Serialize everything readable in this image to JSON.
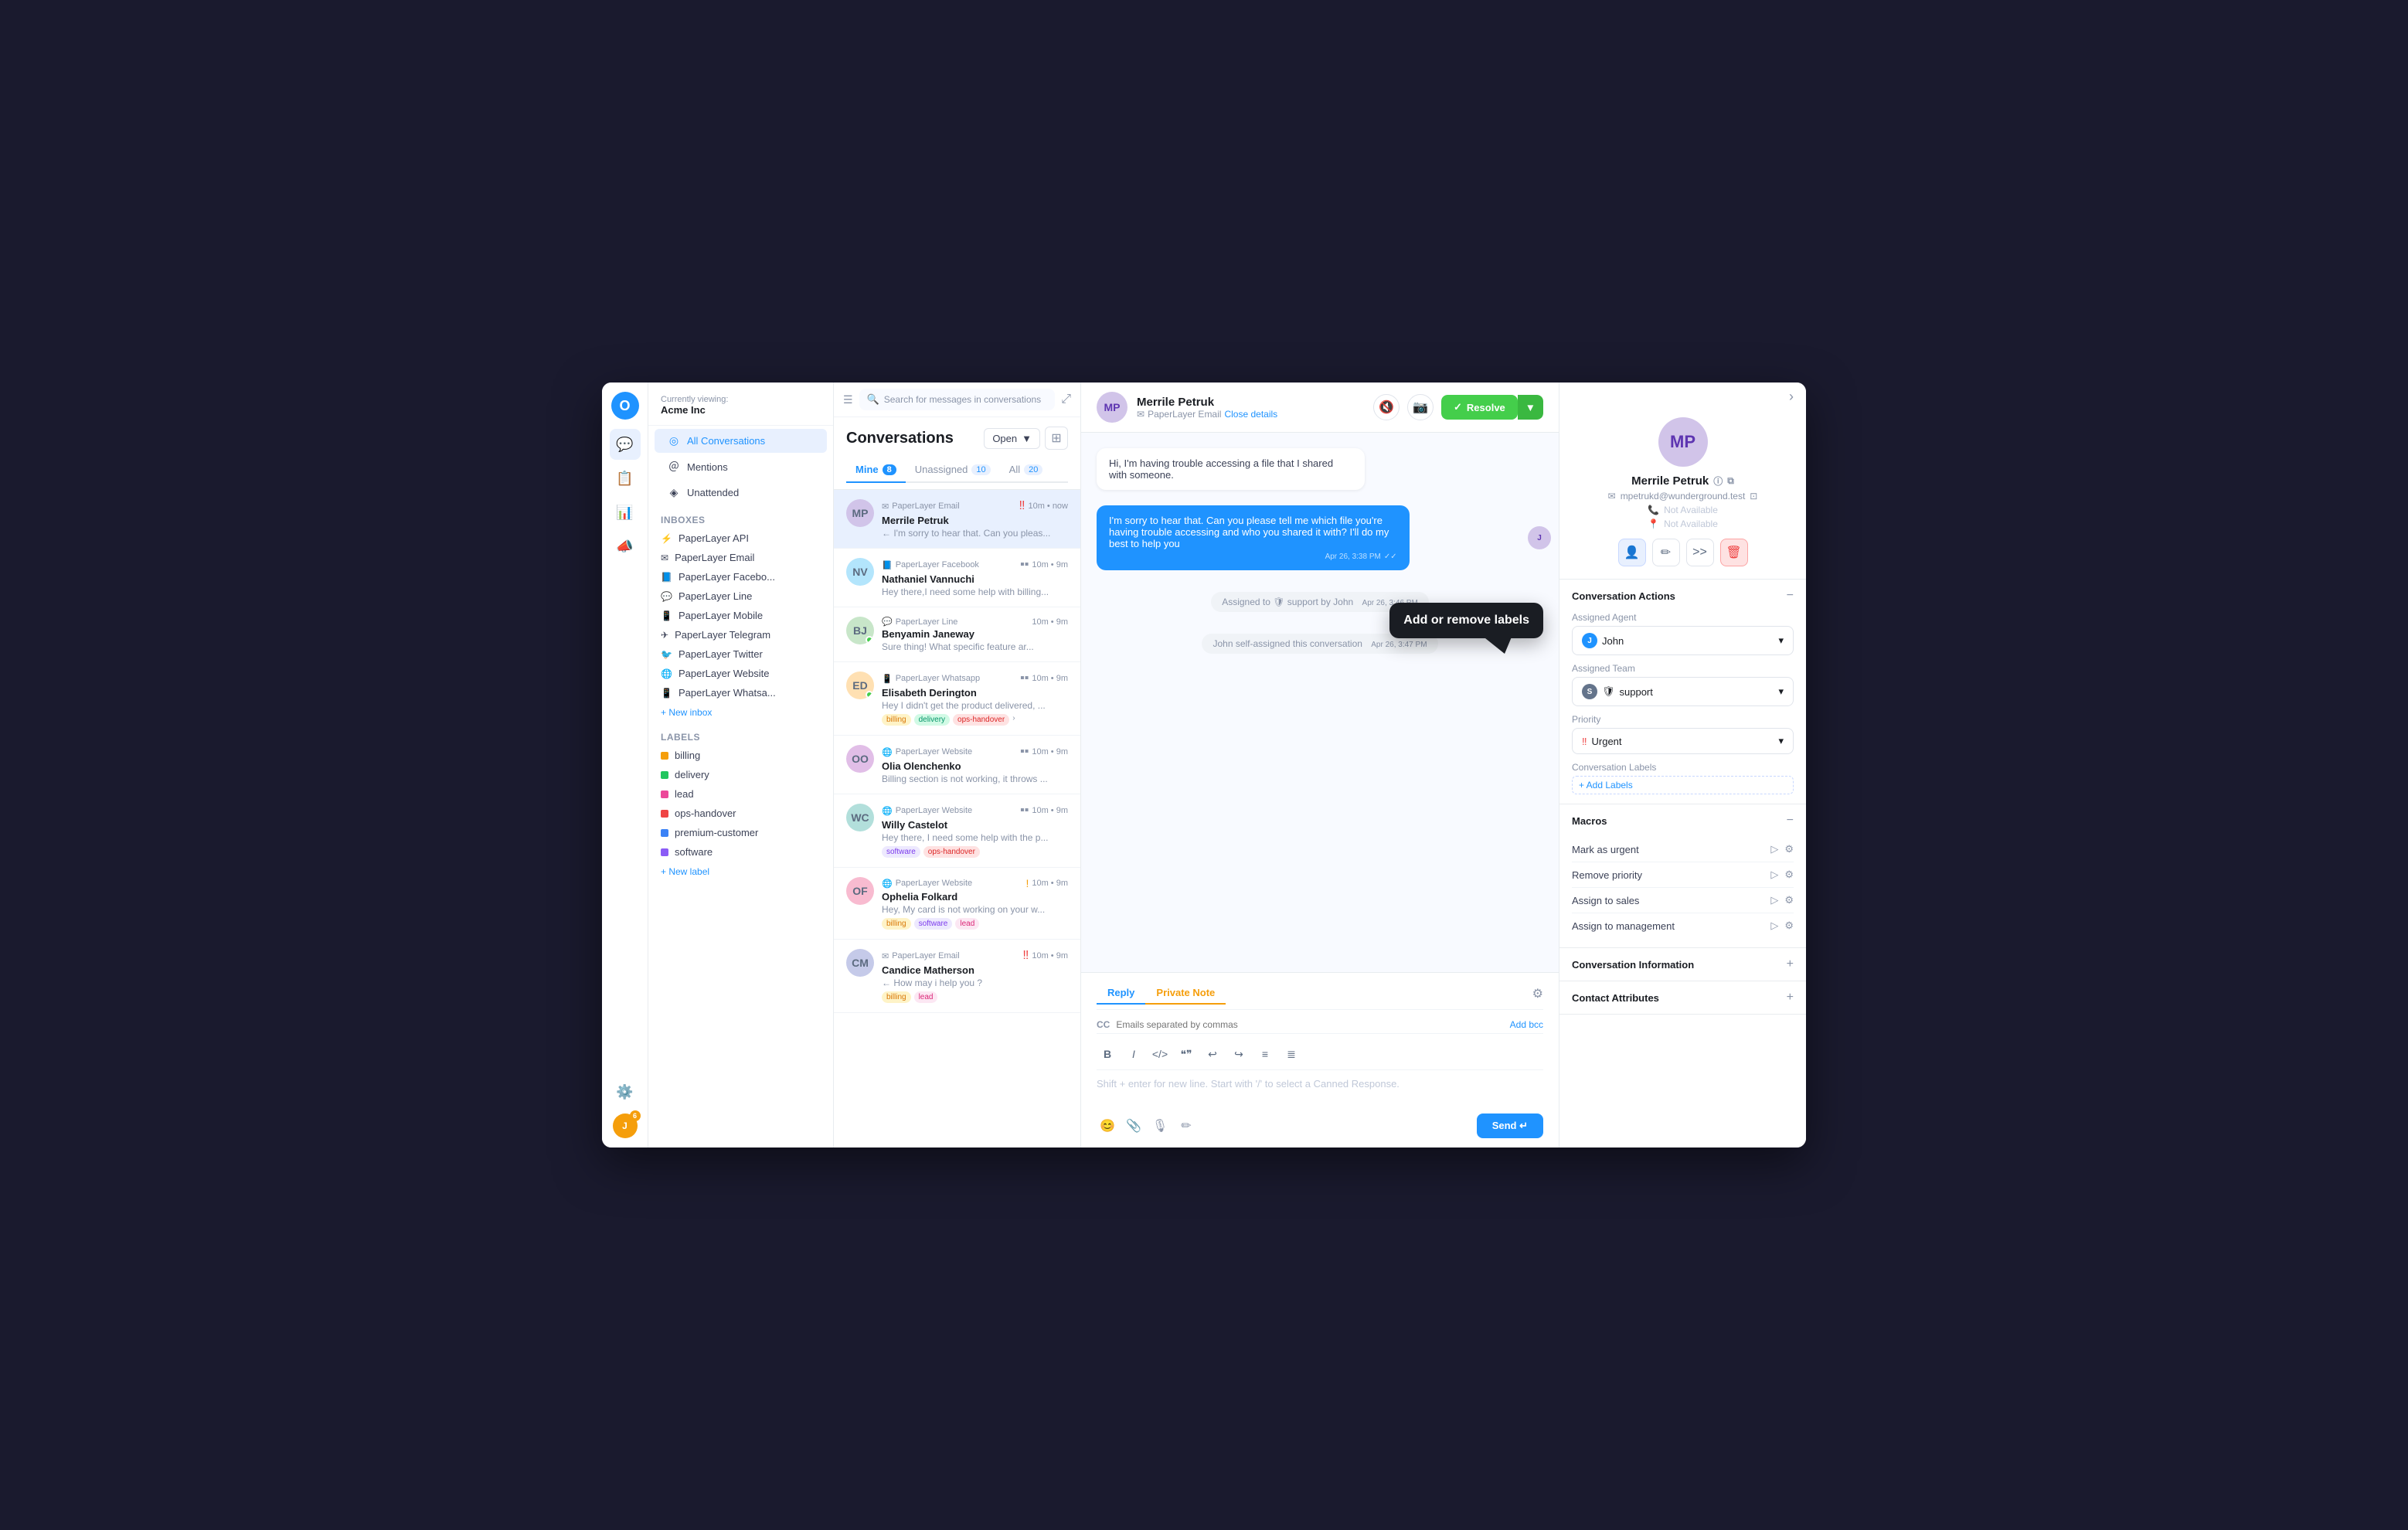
{
  "app": {
    "logo": "O",
    "viewing_label": "Currently viewing:",
    "company": "Acme Inc"
  },
  "left_nav": {
    "icons": [
      "💬",
      "📋",
      "📊",
      "📣",
      "⚙️"
    ],
    "notification_count": "6"
  },
  "sidebar": {
    "conversations_section": {
      "items": [
        {
          "id": "all",
          "label": "All Conversations",
          "icon": "◎",
          "active": true
        },
        {
          "id": "mentions",
          "label": "Mentions",
          "icon": "＠"
        },
        {
          "id": "unattended",
          "label": "Unattended",
          "icon": "◈"
        }
      ]
    },
    "inboxes_title": "Inboxes",
    "inboxes": [
      {
        "label": "PaperLayer API",
        "icon": "⚡"
      },
      {
        "label": "PaperLayer Email",
        "icon": "✉"
      },
      {
        "label": "PaperLayer Facebo...",
        "icon": "📘"
      },
      {
        "label": "PaperLayer Line",
        "icon": "💬"
      },
      {
        "label": "PaperLayer Mobile",
        "icon": "📱"
      },
      {
        "label": "PaperLayer Telegram",
        "icon": "✈"
      },
      {
        "label": "PaperLayer Twitter",
        "icon": "🐦"
      },
      {
        "label": "PaperLayer Website",
        "icon": "🌐"
      },
      {
        "label": "PaperLayer Whatsa...",
        "icon": "📱"
      }
    ],
    "new_inbox": "+ New inbox",
    "labels_title": "Labels",
    "labels": [
      {
        "label": "billing",
        "color": "#f59e0b"
      },
      {
        "label": "delivery",
        "color": "#22c55e"
      },
      {
        "label": "lead",
        "color": "#ec4899"
      },
      {
        "label": "ops-handover",
        "color": "#ef4444"
      },
      {
        "label": "premium-customer",
        "color": "#3b82f6"
      },
      {
        "label": "software",
        "color": "#8b5cf6"
      }
    ],
    "new_label": "+ New label"
  },
  "conv_list": {
    "title": "Conversations",
    "status_btn": "Open",
    "tabs": [
      {
        "id": "mine",
        "label": "Mine",
        "count": "8",
        "active": true
      },
      {
        "id": "unassigned",
        "label": "Unassigned",
        "count": "10"
      },
      {
        "id": "all",
        "label": "All",
        "count": "20"
      }
    ],
    "conversations": [
      {
        "id": 1,
        "channel": "PaperLayer Email",
        "channel_icon": "✉",
        "name": "Merrile Petruk",
        "time": "10m • now",
        "preview": "← I'm sorry to hear that. Can you pleas...",
        "selected": true,
        "priority": "urgent",
        "tags": [],
        "avatar_text": "MP",
        "avatar_color": "#d1c4e9"
      },
      {
        "id": 2,
        "channel": "PaperLayer Facebook",
        "channel_icon": "📘",
        "name": "Nathaniel Vannuchi",
        "time": "10m • 9m",
        "preview": "Hey there,I need some help with billing...",
        "tags": [],
        "avatar_text": "NV",
        "avatar_color": "#b3e5fc"
      },
      {
        "id": 3,
        "channel": "PaperLayer Line",
        "channel_icon": "💬",
        "name": "Benyamin Janeway",
        "time": "10m • 9m",
        "preview": "Sure thing! What specific feature ar...",
        "tags": [],
        "avatar_text": "BJ",
        "avatar_color": "#c8e6c9",
        "online": true
      },
      {
        "id": 4,
        "channel": "PaperLayer Whatsapp",
        "channel_icon": "📱",
        "name": "Elisabeth Derington",
        "time": "10m • 9m",
        "preview": "Hey I didn't get the product delivered, ...",
        "tags": [
          "billing",
          "delivery",
          "ops-handover"
        ],
        "avatar_text": "ED",
        "avatar_color": "#ffe0b2",
        "online": true
      },
      {
        "id": 5,
        "channel": "PaperLayer Website",
        "channel_icon": "🌐",
        "name": "Olia Olenchenko",
        "time": "10m • 9m",
        "preview": "Billing section is not working, it throws ...",
        "tags": [],
        "avatar_text": "OO",
        "avatar_color": "#e1bee7"
      },
      {
        "id": 6,
        "channel": "PaperLayer Website",
        "channel_icon": "🌐",
        "name": "Willy Castelot",
        "time": "10m • 9m",
        "preview": "Hey there, I need some help with the p...",
        "tags": [
          "software",
          "ops-handover"
        ],
        "avatar_text": "WC",
        "avatar_color": "#b2dfdb"
      },
      {
        "id": 7,
        "channel": "PaperLayer Website",
        "channel_icon": "🌐",
        "name": "Ophelia Folkard",
        "time": "10m • 9m",
        "preview": "Hey, My card is not working on your w...",
        "tags": [
          "billing",
          "software",
          "lead"
        ],
        "avatar_text": "OF",
        "avatar_color": "#f8bbd0",
        "priority": "low"
      },
      {
        "id": 8,
        "channel": "PaperLayer Email",
        "channel_icon": "✉",
        "name": "Candice Matherson",
        "time": "10m • 9m",
        "preview": "← How may i help you ?",
        "tags": [
          "billing",
          "lead"
        ],
        "avatar_text": "CM",
        "avatar_color": "#c5cae9",
        "priority": "urgent"
      }
    ]
  },
  "chat": {
    "header": {
      "name": "Merrile Petruk",
      "channel": "PaperLayer Email",
      "close_details": "Close details"
    },
    "messages": [
      {
        "id": 1,
        "type": "user",
        "text": "Hi, I'm having trouble accessing a file that I shared with someone.",
        "time": ""
      },
      {
        "id": 2,
        "type": "agent",
        "text": "I'm sorry to hear that. Can you please tell me which file you're having trouble accessing and who you shared it with? I'll do my best to help you",
        "time": "Apr 26, 3:38 PM",
        "read": true
      },
      {
        "id": 3,
        "type": "system",
        "text": "Assigned to 🛡 support by John",
        "time": "Apr 26, 3:46 PM"
      },
      {
        "id": 4,
        "type": "system",
        "text": "John self-assigned this conversation",
        "time": "Apr 26, 3:47 PM"
      }
    ],
    "input": {
      "tab_reply": "Reply",
      "tab_private": "Private Note",
      "cc_label": "CC",
      "cc_placeholder": "Emails separated by commas",
      "add_bcc": "Add bcc",
      "placeholder": "Shift + enter for new line. Start with '/' to select a Canned Response.",
      "send_btn": "Send ↵"
    },
    "tooltip": {
      "text": "Add or remove labels"
    }
  },
  "right_panel": {
    "contact": {
      "name": "Merrile Petruk",
      "email": "mpetrukd@wunderground.test",
      "phone": "Not Available",
      "location": "Not Available"
    },
    "conversation_actions": {
      "title": "Conversation Actions",
      "assigned_agent_label": "Assigned Agent",
      "assigned_agent": "John",
      "assigned_agent_color": "#1f93ff",
      "assigned_team_label": "Assigned Team",
      "assigned_team": "support",
      "priority_label": "Priority",
      "priority": "Urgent",
      "priority_color": "#ef4444",
      "conv_labels_label": "Conversation Labels",
      "add_labels": "+ Add Labels"
    },
    "macros": {
      "title": "Macros",
      "items": [
        {
          "label": "Mark as urgent"
        },
        {
          "label": "Remove priority"
        },
        {
          "label": "Assign to sales"
        },
        {
          "label": "Assign to management"
        }
      ]
    },
    "conv_info": {
      "title": "Conversation Information",
      "toggle": "+"
    },
    "contact_attr": {
      "title": "Contact Attributes",
      "toggle": "+"
    }
  },
  "search": {
    "placeholder": "Search for messages in conversations"
  }
}
